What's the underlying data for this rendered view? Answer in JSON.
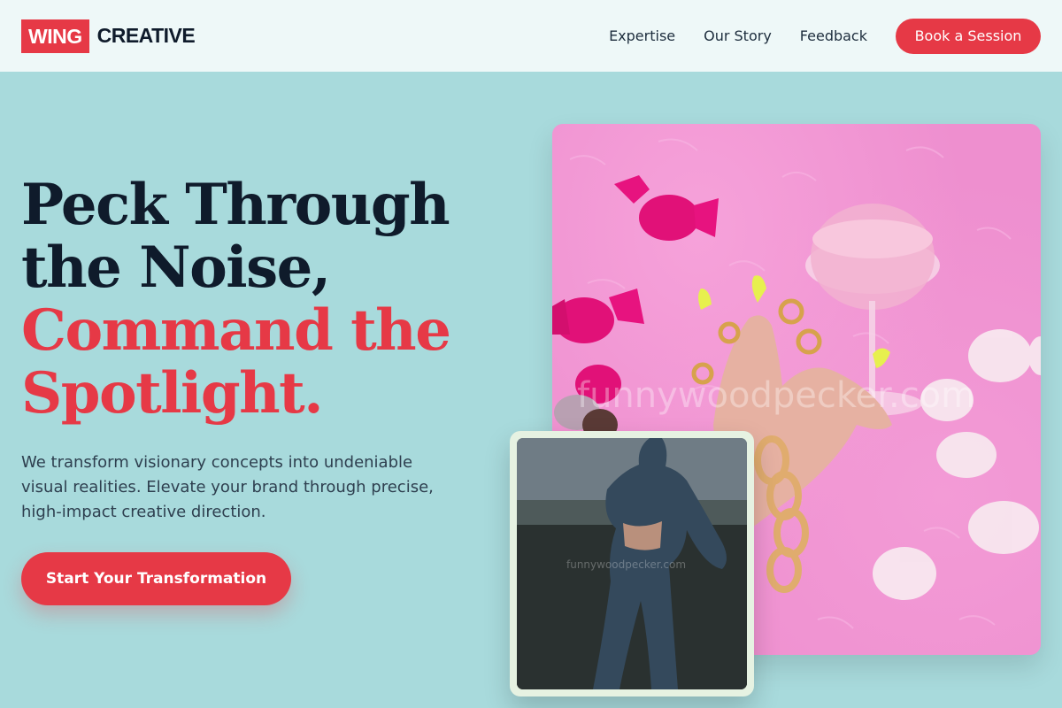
{
  "header": {
    "logo_mark": "WING",
    "logo_word": "CREATIVE",
    "nav": [
      "Expertise",
      "Our Story",
      "Feedback"
    ],
    "cta": "Book a Session"
  },
  "hero": {
    "title_lines": [
      "Peck Through",
      "the Noise,",
      "Command the",
      "Spotlight."
    ],
    "subtitle": "We transform visionary concepts into undeniable visual realities. Elevate your brand through precise, high-impact creative direction.",
    "cta": "Start Your Transformation"
  },
  "images": {
    "main_watermark": "funnywoodpecker.com",
    "secondary_watermark": "funnywoodpecker.com"
  },
  "colors": {
    "accent": "#e63946",
    "background": "#a8dadc",
    "header_bg": "#eef8f8",
    "text_dark": "#0f1b2b"
  }
}
